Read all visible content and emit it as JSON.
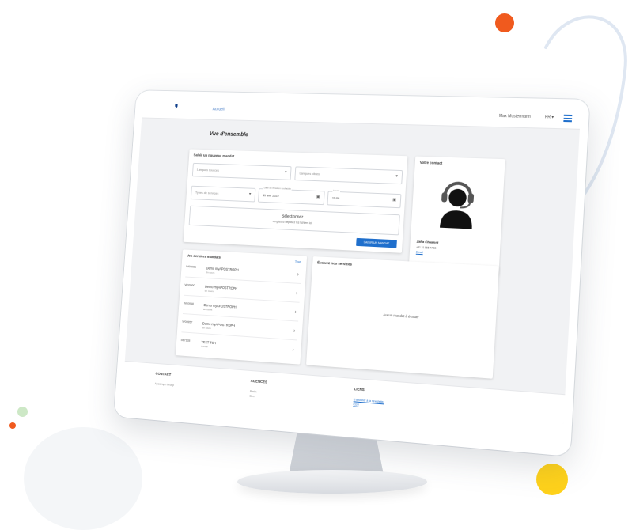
{
  "app": {
    "logo": "❜",
    "nav_home": "Accueil",
    "user_name": "Max Mustermann",
    "language": "FR ▾"
  },
  "page": {
    "title": "Vue d'ensemble"
  },
  "new_mandate": {
    "title": "Saisir un nouveau mandat",
    "source_language_placeholder": "Langues sources",
    "target_language_placeholder": "Langues cibles",
    "service_type_placeholder": "Types de services",
    "delivery_date_label": "Date de livraison souhaitée",
    "delivery_date_value": "11 avr. 2022",
    "time_label": "Heure",
    "time_value": "11:00",
    "upload_title": "Sélectionnez",
    "upload_sub": "ou glissez-déposez les fichiers ici",
    "submit_label": "SAISIR UN MANDAT"
  },
  "contact": {
    "title": "Votre contact",
    "name": "Zafia Chaalent",
    "phone": "+41 21 555 77 90",
    "email": "Email"
  },
  "recent": {
    "title": "Vos derniers mandats",
    "see_all": "Tous",
    "rows": [
      {
        "id": "W00961",
        "name": "Demo myAPOSTROPH",
        "status": "En cours"
      },
      {
        "id": "W00960",
        "name": "Demo myAPOSTROPH",
        "status": "En cours"
      },
      {
        "id": "W00958",
        "name": "Demo myAPOSTROPH",
        "status": "En cours"
      },
      {
        "id": "W00957",
        "name": "Demo myAPOSTROPH",
        "status": "En cours"
      },
      {
        "id": "567128",
        "name": "TEST TCH",
        "status": "Annulé"
      }
    ]
  },
  "evaluate": {
    "title": "Évaluez nos services",
    "empty": "Aucun mandat à évaluer"
  },
  "footer": {
    "contact": {
      "heading": "CONTACT",
      "company": "Apostroph Group",
      "address_lines": [
        "Apostroph Luzern AG",
        "Töpferstrasse 5",
        "CH-6004 Luzern"
      ]
    },
    "agencies": {
      "heading": "AGENCES",
      "items": [
        "Berlin",
        "Bern",
        "Bienne",
        "Hamburg",
        "Lausanne",
        "Lugano"
      ]
    },
    "links": {
      "heading": "LIENS",
      "items": [
        "S'abonner à la newsletter",
        "CGV",
        "Protection des données",
        "Mentions légales",
        "Aide"
      ]
    }
  },
  "colors": {
    "accent": "#1f6fcc",
    "brand_dark": "#0d3d8a",
    "orange": "#f05a1e",
    "yellow": "#ffd21a",
    "green": "#cde8c6"
  }
}
